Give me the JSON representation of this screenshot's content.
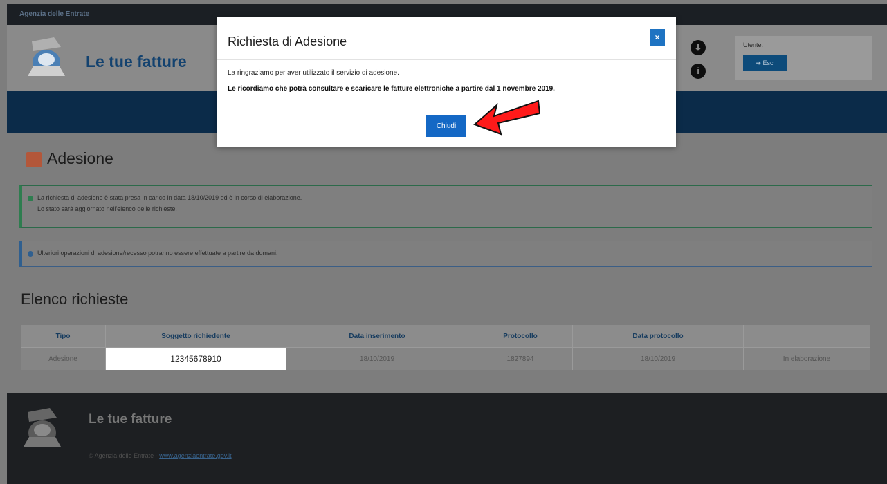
{
  "agency_bar": {
    "title": "Agenzia delle Entrate"
  },
  "header": {
    "app_title": "Le tue fatture",
    "user_label": "Utente:",
    "exit_label": "Esci"
  },
  "page": {
    "title": "Adesione"
  },
  "alerts": {
    "success_line1": "La richiesta di adesione è stata presa in carico in data 18/10/2019 ed è in corso di elaborazione.",
    "success_line2": "Lo stato sarà aggiornato nell'elenco delle richieste.",
    "info_text": "Ulteriori operazioni di adesione/recesso potranno essere effettuate a partire da domani."
  },
  "requests": {
    "title": "Elenco richieste",
    "columns": [
      "Tipo",
      "Soggetto richiedente",
      "Data inserimento",
      "Protocollo",
      "Data protocollo",
      ""
    ],
    "rows": [
      [
        "Adesione",
        "12345678910",
        "18/10/2019",
        "1827894",
        "18/10/2019",
        "In elaborazione"
      ]
    ]
  },
  "footer": {
    "app_title": "Le tue fatture",
    "copyright": "© Agenzia delle Entrate -",
    "link": "www.agenziaentrate.gov.it"
  },
  "modal": {
    "title": "Richiesta di Adesione",
    "close_icon": "×",
    "line1": "La ringraziamo per aver utilizzato il servizio di adesione.",
    "line2": "Le ricordiamo che potrà consultare e scaricare le fatture elettroniche a partire dal 1 novembre 2019.",
    "button": "Chiudi"
  },
  "icons": {
    "download": "download-icon",
    "info": "info-icon",
    "exit": "exit-icon"
  },
  "colors": {
    "accent": "#1468c5",
    "nav": "#0b2b49",
    "annotation_arrow": "#ff0000"
  }
}
